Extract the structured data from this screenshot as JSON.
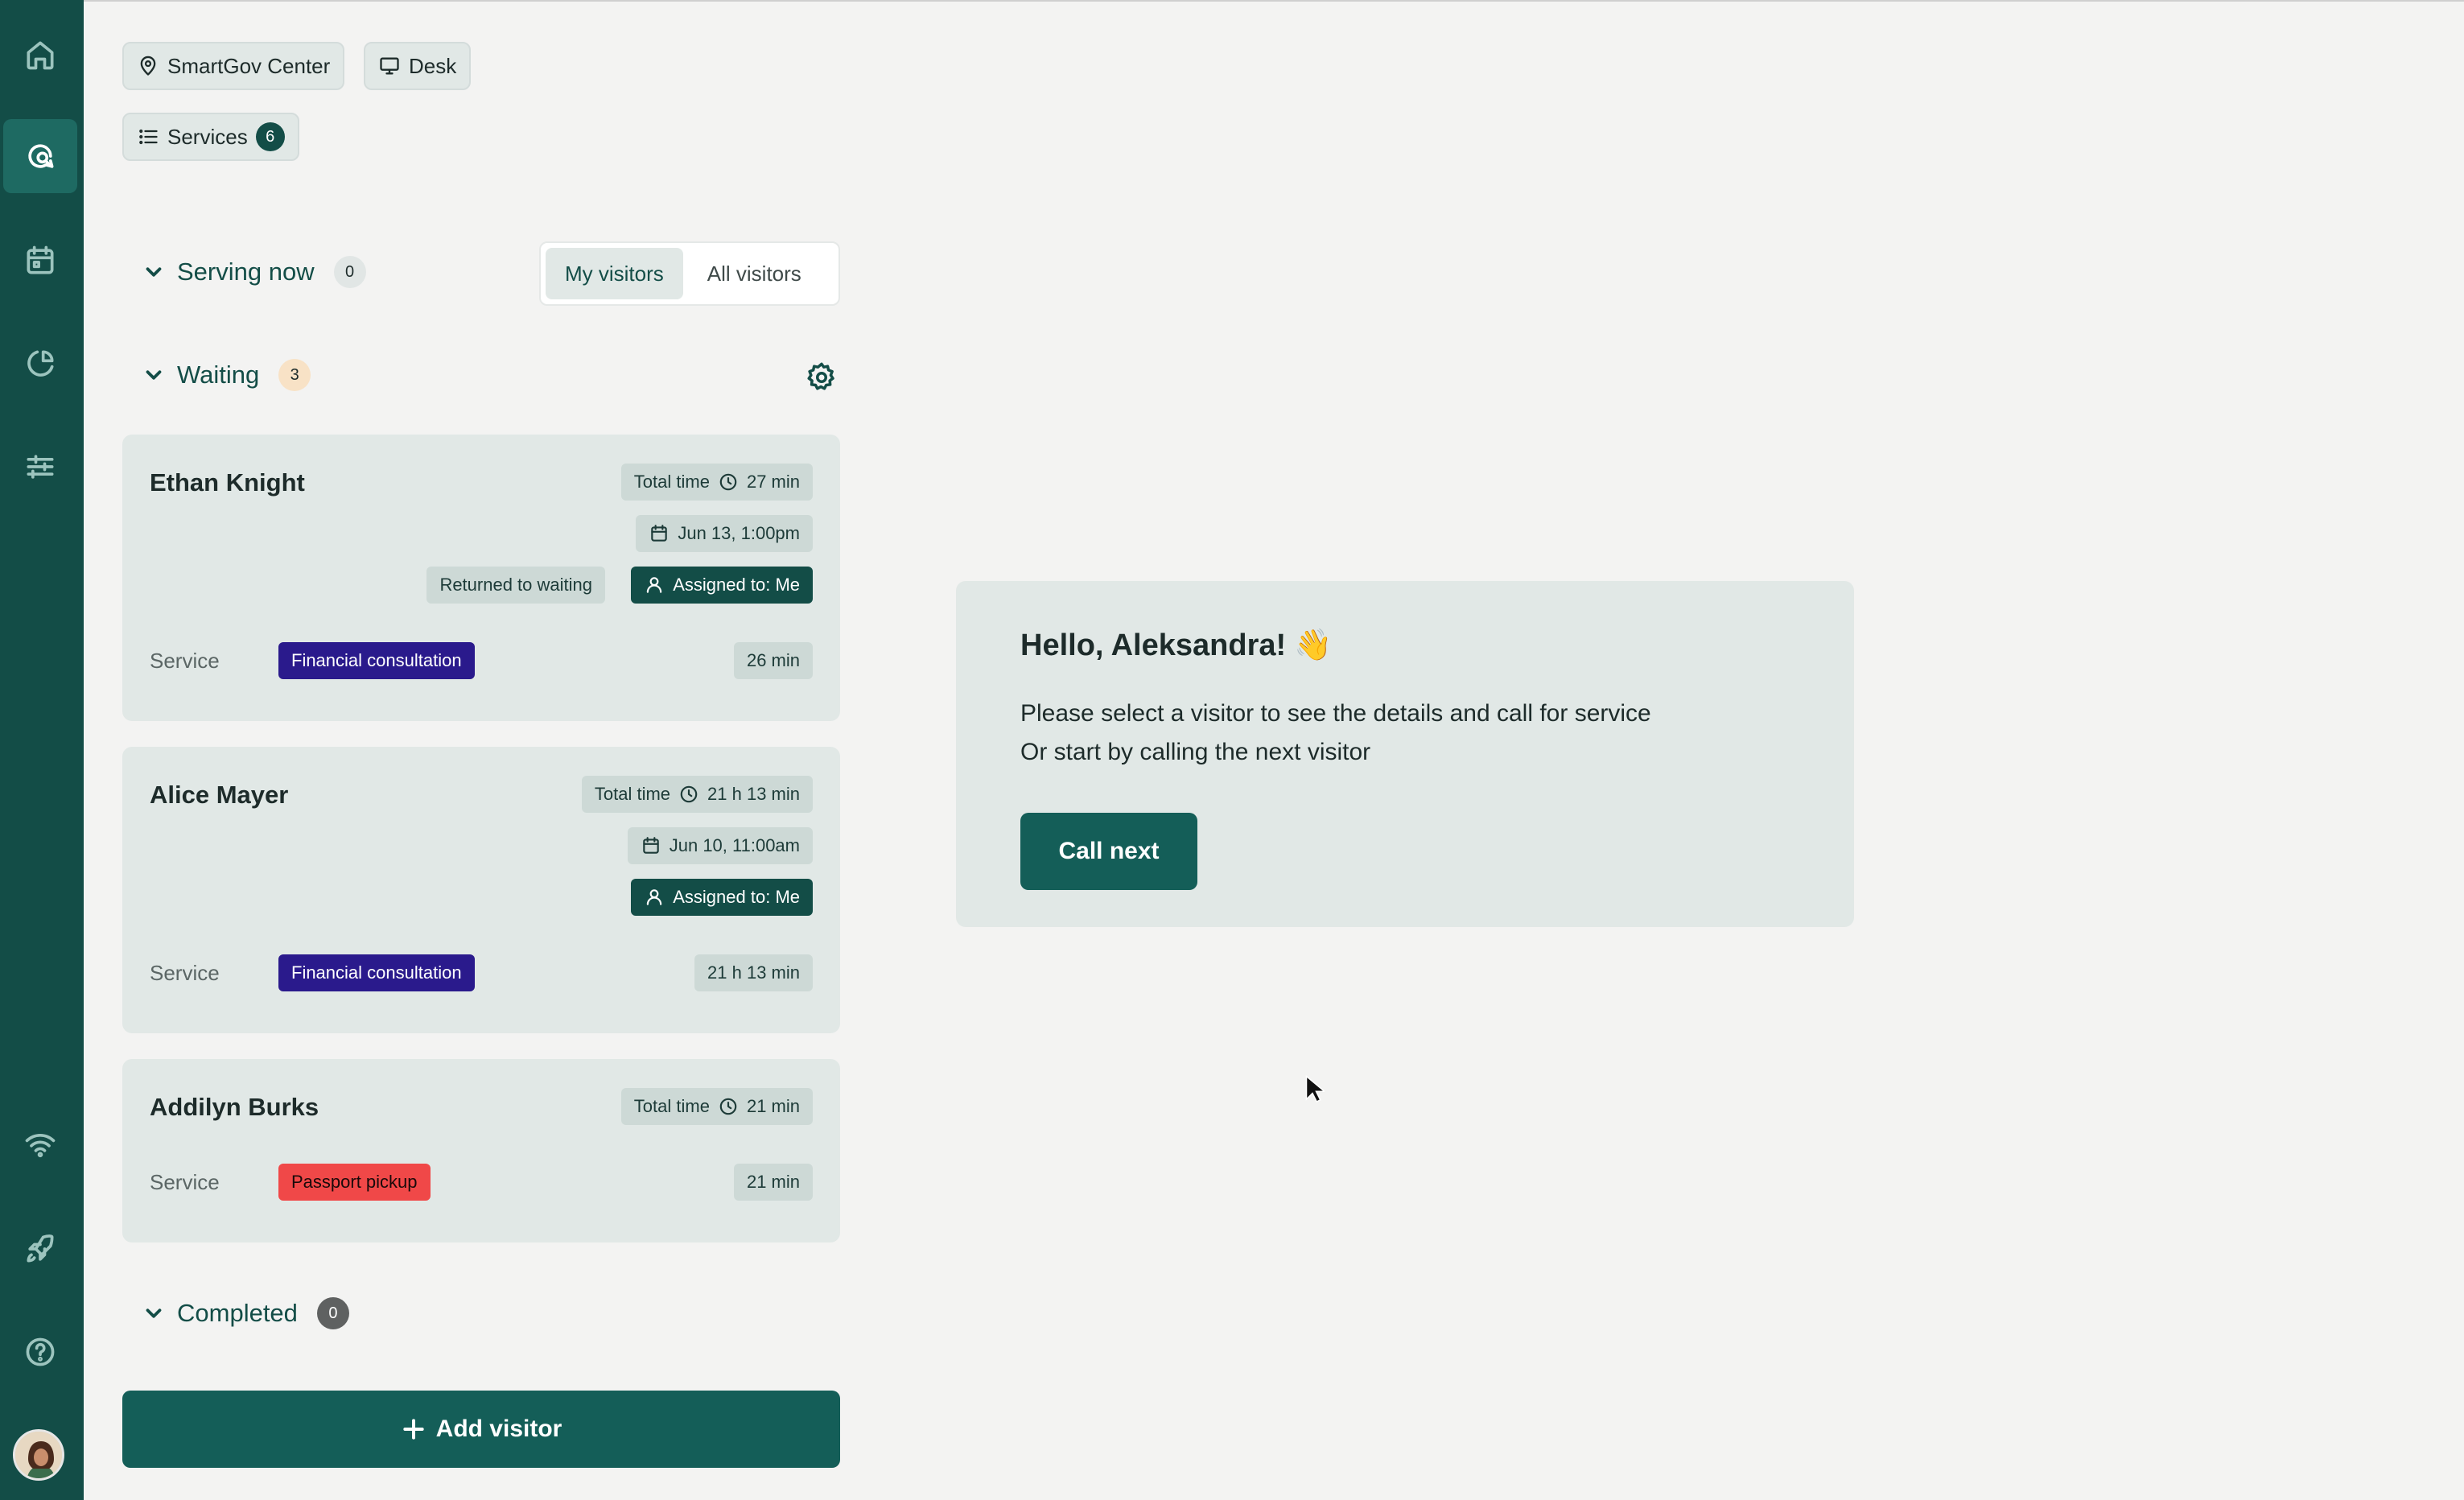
{
  "header": {
    "location_chip": "SmartGov Center",
    "desk_chip": "Desk",
    "services_chip": "Services",
    "services_count": "6"
  },
  "sidebar": {
    "items": [
      {
        "icon": "home-icon"
      },
      {
        "icon": "chat-search-icon",
        "active": true
      },
      {
        "icon": "calendar-icon"
      },
      {
        "icon": "pie-chart-icon"
      },
      {
        "icon": "sliders-icon"
      },
      {
        "icon": "wifi-icon"
      },
      {
        "icon": "rocket-icon"
      },
      {
        "icon": "help-icon"
      }
    ]
  },
  "toggle": {
    "my_visitors": "My visitors",
    "all_visitors": "All visitors"
  },
  "sections": {
    "serving_now": {
      "label": "Serving now",
      "count": "0"
    },
    "waiting": {
      "label": "Waiting",
      "count": "3"
    },
    "completed": {
      "label": "Completed",
      "count": "0"
    }
  },
  "visitors": [
    {
      "name": "Ethan Knight",
      "total_time_label": "Total time",
      "total_time": "27 min",
      "datetime": "Jun 13, 1:00pm",
      "status": "Returned to waiting",
      "assigned": "Assigned to: Me",
      "service_label": "Service",
      "service": "Financial consultation",
      "service_time": "26 min"
    },
    {
      "name": "Alice Mayer",
      "total_time_label": "Total time",
      "total_time": "21 h 13 min",
      "datetime": "Jun 10, 11:00am",
      "assigned": "Assigned to: Me",
      "service_label": "Service",
      "service": "Financial consultation",
      "service_time": "21 h 13 min"
    },
    {
      "name": "Addilyn Burks",
      "total_time_label": "Total time",
      "total_time": "21 min",
      "service_label": "Service",
      "service": "Passport pickup",
      "service_time": "21 min"
    }
  ],
  "add_visitor": "Add visitor",
  "welcome": {
    "title": "Hello, Aleksandra!",
    "emoji": "👋",
    "line1": "Please select a visitor to see the details and call for service",
    "line2": "Or start by calling the next visitor",
    "call_next": "Call next"
  },
  "colors": {
    "sidebar": "#134d47",
    "accent": "#145e58",
    "service_purple": "#2a1a8c",
    "service_red": "#f04848"
  }
}
